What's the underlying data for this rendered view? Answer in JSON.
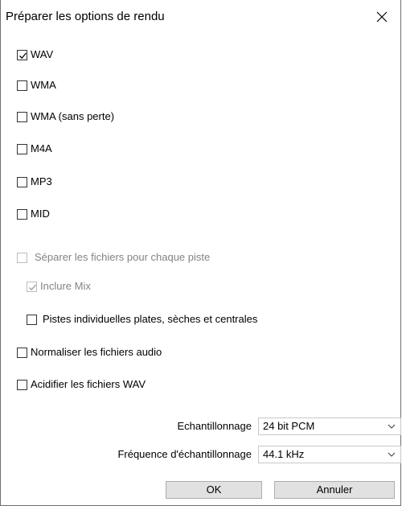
{
  "dialog": {
    "title": "Préparer les options de rendu"
  },
  "formats": [
    {
      "label": "WAV",
      "checked": true
    },
    {
      "label": "WMA",
      "checked": false
    },
    {
      "label": "WMA (sans perte)",
      "checked": false
    },
    {
      "label": "M4A",
      "checked": false
    },
    {
      "label": "MP3",
      "checked": false
    },
    {
      "label": "MID",
      "checked": false
    }
  ],
  "options": {
    "separate_files": {
      "label": "Séparer les fichiers pour chaque piste",
      "checked": false,
      "enabled": false
    },
    "include_mix": {
      "label": "Inclure Mix",
      "checked": true,
      "enabled": false
    },
    "individual_tracks": {
      "label": "Pistes individuelles plates, sèches et centrales",
      "checked": false,
      "enabled": true
    },
    "normalize": {
      "label": "Normaliser les fichiers audio",
      "checked": false,
      "enabled": true
    },
    "acidify": {
      "label": "Acidifier les fichiers WAV",
      "checked": false,
      "enabled": true
    }
  },
  "sampling": {
    "label": "Echantillonnage",
    "value": "24 bit PCM"
  },
  "frequency": {
    "label": "Fréquence d'échantillonnage",
    "value": "44.1 kHz"
  },
  "buttons": {
    "ok": "OK",
    "cancel": "Annuler"
  },
  "colors": {
    "disabled_text": "#838383",
    "button_bg": "#e1e1e1",
    "check_mark": "#000000",
    "disabled_check_mark": "#9a9a9a"
  }
}
